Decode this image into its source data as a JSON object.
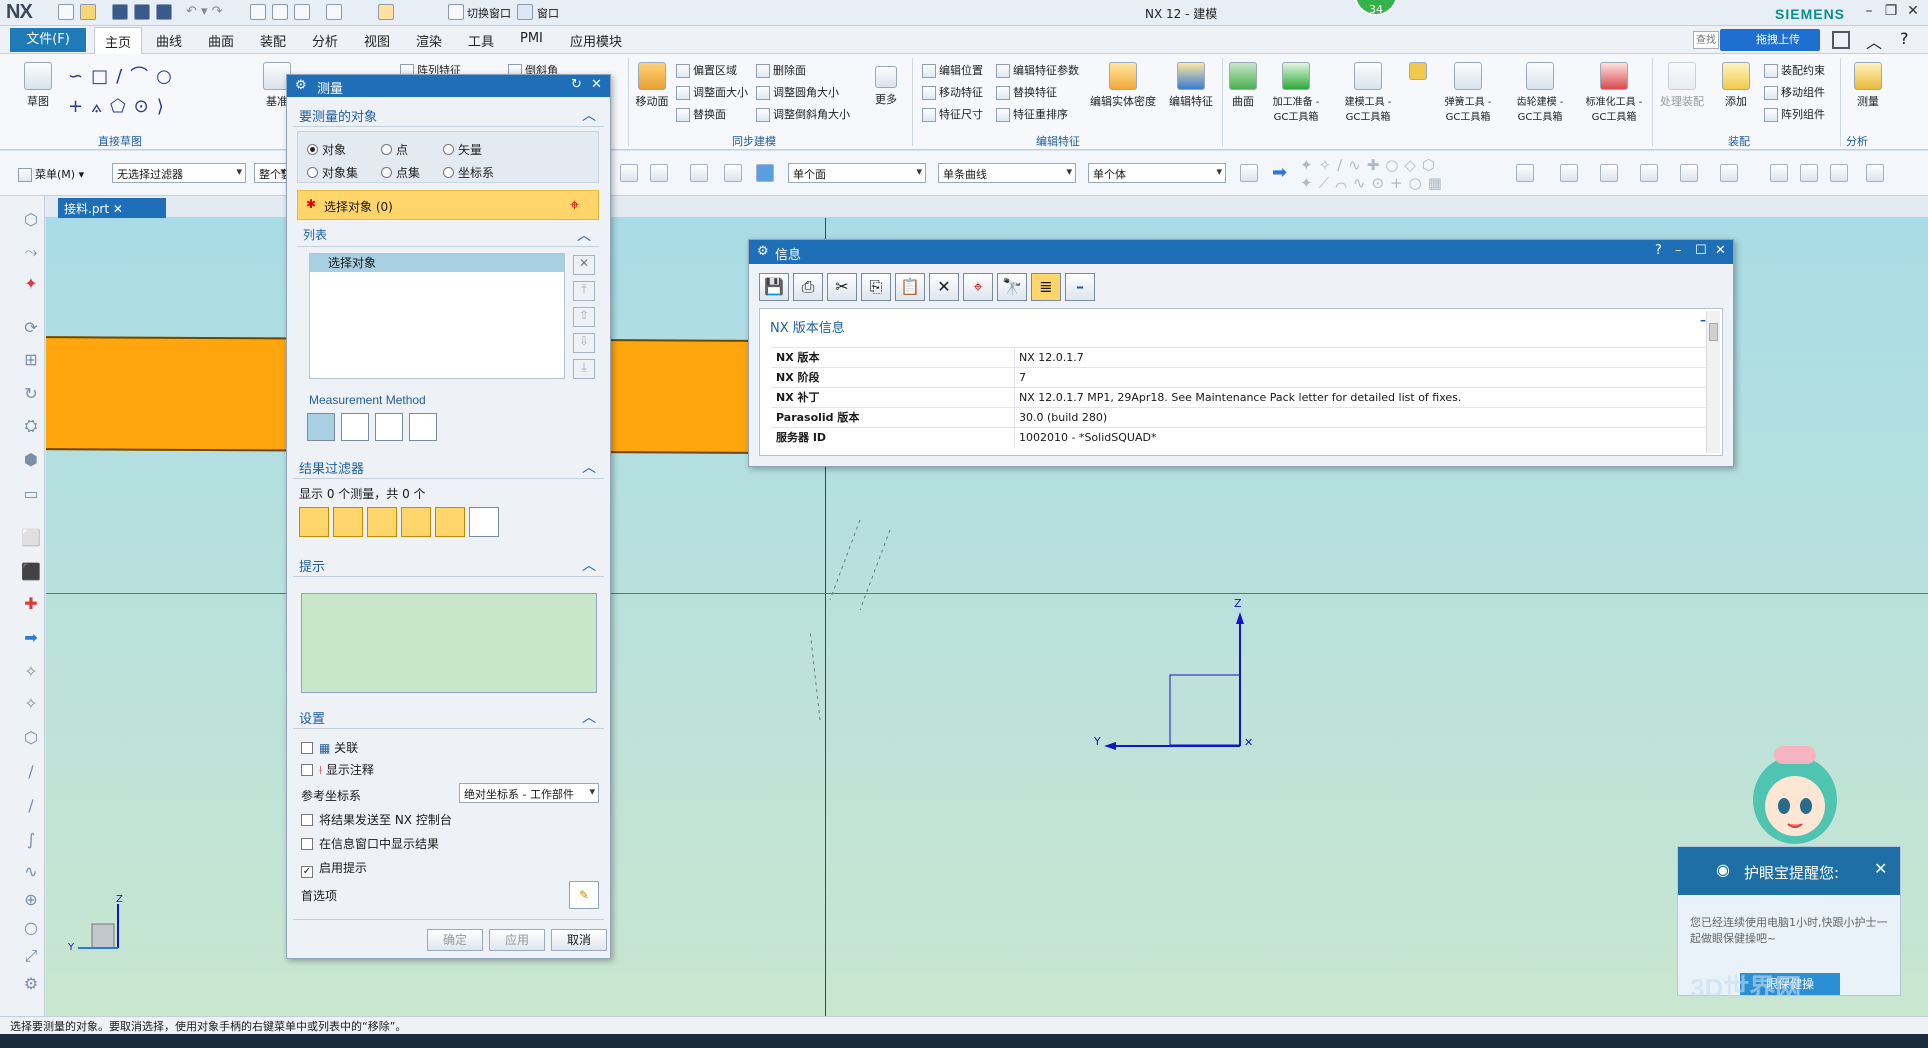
{
  "app": {
    "logo": "NX",
    "title": "NX 12 - 建模",
    "brand": "SIEMENS",
    "badge": "34"
  },
  "menu": {
    "file": "文件(F)",
    "tabs": [
      "主页",
      "曲线",
      "曲面",
      "装配",
      "分析",
      "视图",
      "渲染",
      "工具",
      "PMI",
      "应用模块"
    ],
    "search_placeholder": "查找",
    "upload": "拖拽上传",
    "quick_access": {
      "switch_window": "切换窗口",
      "window": "窗口"
    }
  },
  "ribbon": {
    "sketch": "草图",
    "datum": "基准",
    "direct_sketch_group": "直接草图",
    "sync_items": [
      "偏置区域",
      "调整面大小",
      "替换面",
      "删除面",
      "调整圆角大小",
      "调整倒斜角大小"
    ],
    "move_face": "移动面",
    "more": "更多",
    "sync_group": "同步建模",
    "edit_items": [
      "编辑位置",
      "移动特征",
      "特征尺寸",
      "编辑特征参数",
      "替换特征",
      "特征重排序"
    ],
    "edit_solid_density": "编辑实体密度",
    "edit_feature": "编辑特征",
    "edit_feature_group": "编辑特征",
    "array_feature": "阵列特征",
    "chamfer": "倒斜角",
    "surface": "曲面",
    "gc_tools": [
      "加工准备 - GC工具箱",
      "建模工具 - GC工具箱",
      "弹簧工具 - GC工具箱",
      "齿轮建模 - GC工具箱",
      "标准化工具 - GC工具箱"
    ],
    "process_assembly": "处理装配",
    "add": "添加",
    "assembly_items": [
      "装配约束",
      "移动组件",
      "阵列组件"
    ],
    "assembly_group": "装配",
    "measure": "测量",
    "analysis_group": "分析"
  },
  "selbar": {
    "menu": "菜单(M)",
    "filter": "无选择过滤器",
    "assembly": "整个装",
    "face_rule": "单个面",
    "curve_rule": "单条曲线",
    "body_rule": "单个体"
  },
  "doc": {
    "tab": "接料.prt"
  },
  "measure": {
    "title": "测量",
    "section_objects": "要测量的对象",
    "radios": [
      "对象",
      "点",
      "矢量",
      "对象集",
      "点集",
      "坐标系"
    ],
    "select_object": "选择对象 (0)",
    "list_label": "列表",
    "list_header": "选择对象",
    "method_label": "Measurement Method",
    "results_filter": "结果过滤器",
    "results_text": "显示 0 个测量，共 0 个",
    "hint": "提示",
    "settings": "设置",
    "associate": "关联",
    "show_annotation": "显示注释",
    "ref_csys_label": "参考坐标系",
    "ref_csys_value": "绝对坐标系 - 工作部件",
    "send_console": "将结果发送至 NX 控制台",
    "show_info": "在信息窗口中显示结果",
    "enable_hint": "启用提示",
    "preferences": "首选项",
    "ok": "确定",
    "apply": "应用",
    "cancel": "取消"
  },
  "info": {
    "title": "信息",
    "heading": "NX 版本信息",
    "rows": [
      {
        "key": "NX 版本",
        "value": "NX 12.0.1.7"
      },
      {
        "key": "NX 阶段",
        "value": "7"
      },
      {
        "key": "NX 补丁",
        "value": "NX 12.0.1.7 MP1, 29Apr18. See Maintenance Pack letter for detailed list of fixes."
      },
      {
        "key": "Parasolid 版本",
        "value": "30.0 (build 280)"
      },
      {
        "key": "服务器 ID",
        "value": "1002010 - *SolidSQUAD*"
      }
    ]
  },
  "axes": {
    "z": "Z",
    "y": "Y",
    "x": "X"
  },
  "eyecare": {
    "title": "护眼宝提醒您:",
    "message": "您已经连续使用电脑1小时,快跟小护士一起做眼保健操吧~",
    "button": "眼保健操"
  },
  "watermark": "3D世界网",
  "status": "选择要测量的对象。要取消选择，使用对象手柄的右键菜单中或列表中的“移除”。"
}
